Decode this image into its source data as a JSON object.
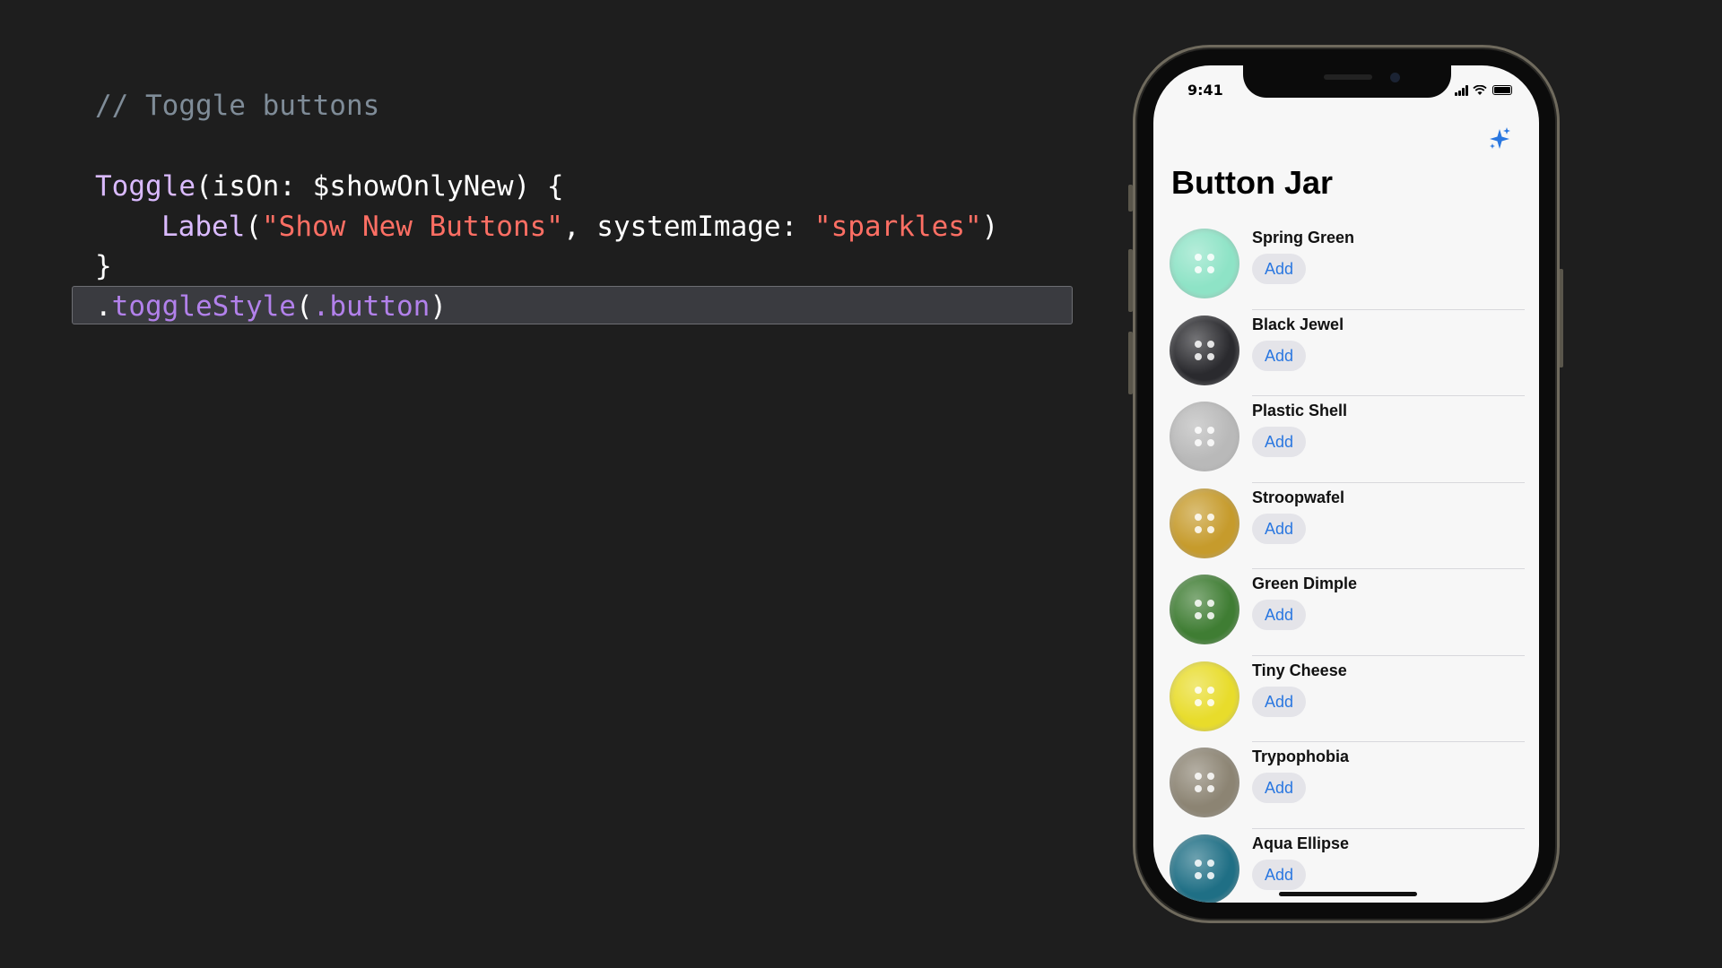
{
  "code": {
    "comment": "// Toggle buttons",
    "line1": {
      "type": "Toggle",
      "rest": "(isOn: $showOnlyNew) {"
    },
    "line2": {
      "type": "Label",
      "open": "(",
      "str1": "\"Show New Buttons\"",
      "mid": ", systemImage: ",
      "str2": "\"sparkles\"",
      "close": ")"
    },
    "line3": "}",
    "line4": {
      "dot": ".",
      "method": "toggleStyle",
      "open": "(",
      "arg": ".button",
      "close": ")"
    }
  },
  "phone": {
    "status": {
      "time": "9:41"
    },
    "toolbar": {
      "sparkles_icon": "sparkles-icon"
    },
    "title": "Button Jar",
    "items": [
      {
        "name": "Spring Green",
        "add_label": "Add",
        "color": "#8ee3c6"
      },
      {
        "name": "Black Jewel",
        "add_label": "Add",
        "color": "#2a2a2e"
      },
      {
        "name": "Plastic Shell",
        "add_label": "Add",
        "color": "#b9b9b9"
      },
      {
        "name": "Stroopwafel",
        "add_label": "Add",
        "color": "#c69b2c"
      },
      {
        "name": "Green Dimple",
        "add_label": "Add",
        "color": "#3f7d33"
      },
      {
        "name": "Tiny Cheese",
        "add_label": "Add",
        "color": "#e8dc2b"
      },
      {
        "name": "Trypophobia",
        "add_label": "Add",
        "color": "#8c8473"
      },
      {
        "name": "Aqua Ellipse",
        "add_label": "Add",
        "color": "#1f6f85"
      }
    ]
  }
}
